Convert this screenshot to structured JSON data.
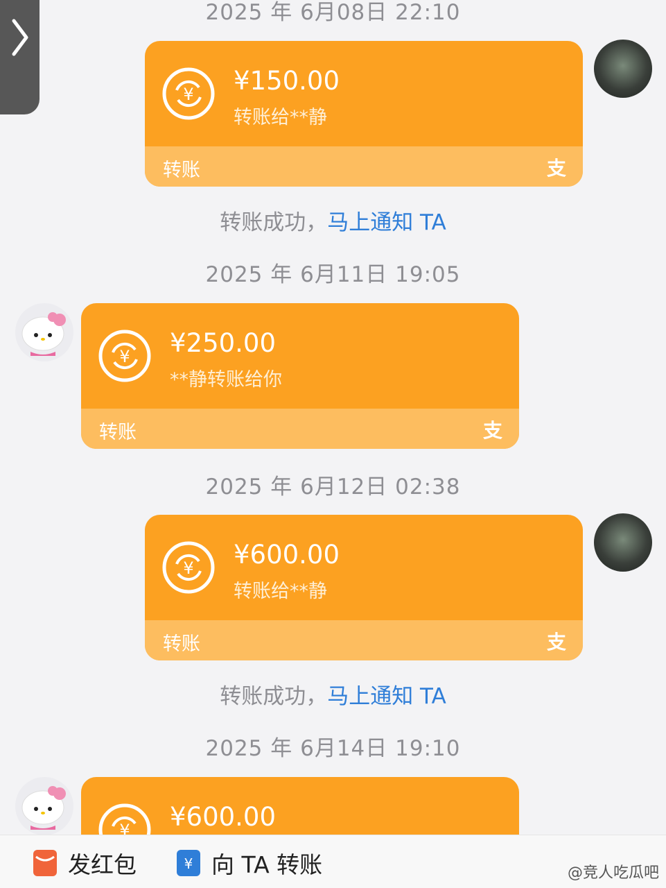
{
  "timestamps": [
    "2025 年 6月08日 22:10",
    "2025 年 6月11日 19:05",
    "2025 年 6月12日 02:38",
    "2025 年 6月14日 19:10"
  ],
  "messages": [
    {
      "amount": "¥150.00",
      "desc": "转账给**静",
      "footer": "转账"
    },
    {
      "amount": "¥250.00",
      "desc": "**静转账给你",
      "footer": "转账"
    },
    {
      "amount": "¥600.00",
      "desc": "转账给**静",
      "footer": "转账"
    },
    {
      "amount": "¥600.00"
    }
  ],
  "status": {
    "text": "转账成功，",
    "link": "马上通知 TA"
  },
  "footer_icon": "支",
  "bottom_bar": {
    "red_packet": "发红包",
    "transfer": "向 TA 转账"
  },
  "watermark": "@竞人吃瓜吧",
  "icons": {
    "back": "chevron-right-icon",
    "coin": "yuan-transfer-icon",
    "alipay": "alipay-icon"
  },
  "colors": {
    "bubble": "#fca121",
    "bubble_footer": "#fdbd5f",
    "link": "#2f7ed8"
  }
}
